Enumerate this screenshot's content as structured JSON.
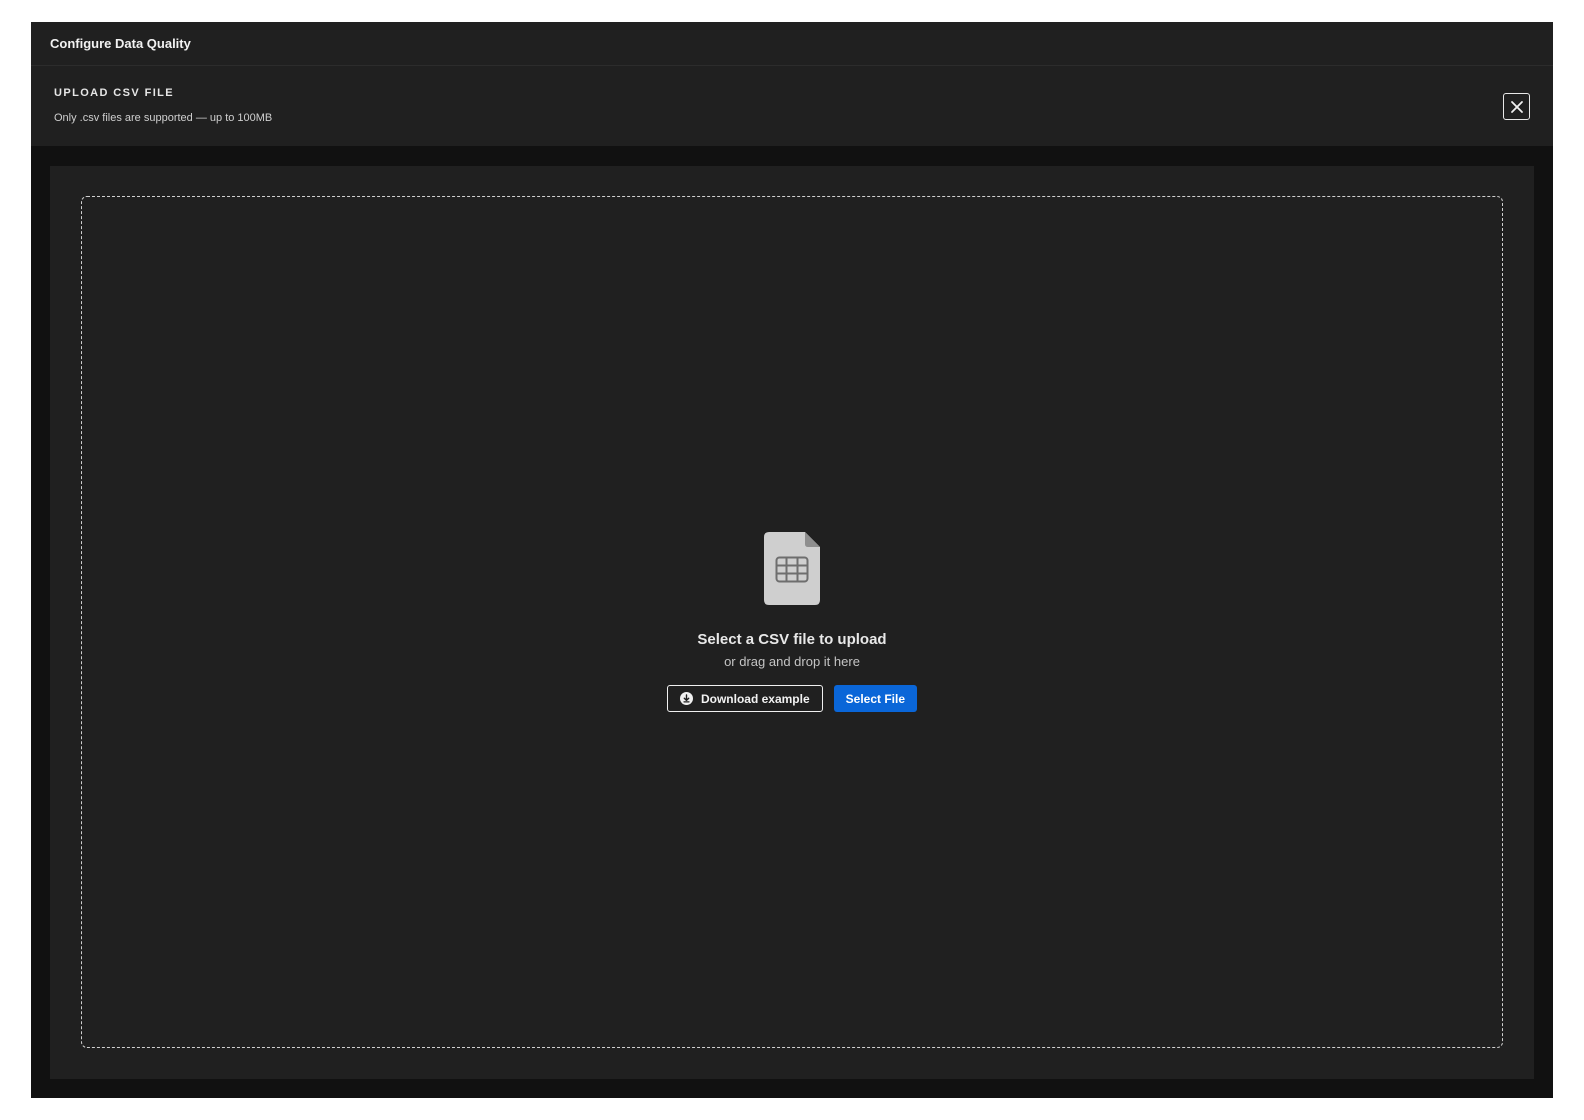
{
  "window": {
    "title": "Configure Data Quality"
  },
  "header": {
    "heading": "UPLOAD CSV FILE",
    "subheading": "Only .csv files are supported — up to 100MB",
    "close_icon": "close-icon"
  },
  "dropzone": {
    "icon": "csv-file-icon",
    "prompt_main": "Select a CSV file to upload",
    "prompt_sub": "or drag and drop it here",
    "download_button": {
      "label": "Download example",
      "icon": "download-icon"
    },
    "select_button": {
      "label": "Select File"
    }
  },
  "colors": {
    "background": "#111111",
    "panel": "#202020",
    "accent": "#0a66d8",
    "text": "#f2f2f2"
  }
}
